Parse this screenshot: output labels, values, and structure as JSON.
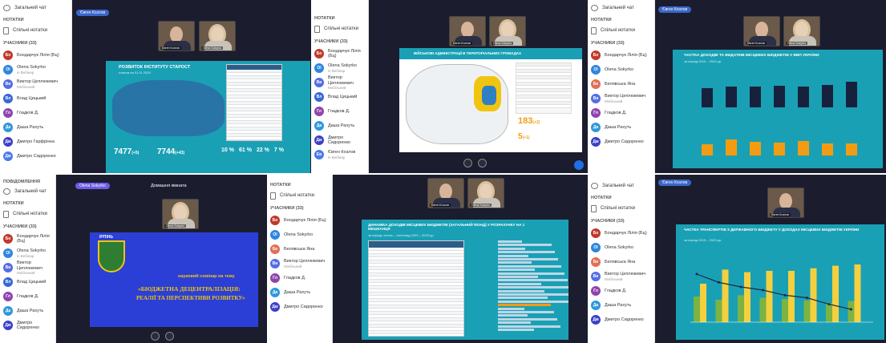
{
  "host_name": "Євген Козлов",
  "cam_labels": {
    "host": "Євген Козлов",
    "guest": "Olena Sokyrko"
  },
  "sidebar": {
    "general_chat": "Загальний чат",
    "notes_header": "НОТАТКИ",
    "shared_notes": "Спільні нотатки",
    "participants_label": "УЧАСНИКИ (33)",
    "participants_label_b": "УЧАСНИКИ (33)",
    "notifications": "ПОВІДОМЛЕННЯ"
  },
  "participants": [
    {
      "initials": "Бо",
      "name": "Бондарчук Лілія (Бц)",
      "sub": "",
      "color": "#c0392b"
    },
    {
      "initials": "Ol",
      "name": "Olena Sokyrko",
      "sub": "in Вебінар",
      "color": "#2e86de"
    },
    {
      "initials": "Ви",
      "name": "Виктор Цеплюкевич",
      "sub": "Мобільний",
      "color": "#546de5"
    },
    {
      "initials": "Вл",
      "name": "Влад Цицький",
      "sub": "",
      "color": "#3867d6"
    },
    {
      "initials": "Гл",
      "name": "Гладков Д.",
      "sub": "",
      "color": "#8e44ad"
    },
    {
      "initials": "Да",
      "name": "Даша Рахуть",
      "sub": "",
      "color": "#2d98da"
    },
    {
      "initials": "Дм",
      "name": "Дмитро Гарфрінка",
      "sub": "",
      "color": "#3c40c6"
    },
    {
      "initials": "Дм",
      "name": "Дмитро Сидоренко",
      "sub": "",
      "color": "#4b7bec"
    }
  ],
  "participants_b": [
    {
      "initials": "Бо",
      "name": "Бондарчук Лілія (Бц)",
      "sub": "",
      "color": "#c0392b"
    },
    {
      "initials": "Ol",
      "name": "Olena Sokyrko",
      "sub": "in Вебінар",
      "color": "#2e86de"
    },
    {
      "initials": "Ви",
      "name": "Виктор Цеплюкевич",
      "sub": "Мобільний",
      "color": "#546de5"
    },
    {
      "initials": "Вл",
      "name": "Влад Цицький",
      "sub": "",
      "color": "#3867d6"
    },
    {
      "initials": "Гл",
      "name": "Гладков Д.",
      "sub": "",
      "color": "#8e44ad"
    },
    {
      "initials": "Да",
      "name": "Даша Рахуть",
      "sub": "",
      "color": "#2d98da"
    },
    {
      "initials": "Дм",
      "name": "Дмитро Сидоренко",
      "sub": "",
      "color": "#3c40c6"
    },
    {
      "initials": "Ев",
      "name": "Євген Козлов",
      "sub": "in Вебінар",
      "color": "#4b7bec"
    }
  ],
  "participants_c": [
    {
      "initials": "Бо",
      "name": "Бондарчук Лілія (Бц)",
      "sub": "",
      "color": "#c0392b"
    },
    {
      "initials": "Ol",
      "name": "Olena Sokyrko",
      "sub": "",
      "color": "#2e86de"
    },
    {
      "initials": "Бе",
      "name": "Белявська Яна",
      "sub": "",
      "color": "#e17055"
    },
    {
      "initials": "Ви",
      "name": "Виктор Цеплюкевич",
      "sub": "Мобільний",
      "color": "#546de5"
    },
    {
      "initials": "Гл",
      "name": "Гладков Д.",
      "sub": "",
      "color": "#8e44ad"
    },
    {
      "initials": "Да",
      "name": "Даша Рахуть",
      "sub": "",
      "color": "#2d98da"
    },
    {
      "initials": "Дм",
      "name": "Дмитро Сидоренко",
      "sub": "",
      "color": "#3c40c6"
    }
  ],
  "panel5": {
    "tab_title": "Домашня кімната",
    "seminar_line1": "науковий семінар на тему",
    "seminar_line2": "«БЮДЖЕТНА ДЕЦЕНТРАЛІЗАЦІЯ:",
    "seminar_line3": "РЕАЛІЇ ТА ПЕРСПЕКТИВИ РОЗВИТКУ»",
    "city_label": "ІРПІНЬ"
  },
  "slides": {
    "s1_title": "РОЗВИТОК ІНСТИТУТУ СТАРОСТ",
    "s1_sub": "станом на 01.01.2024",
    "s1_stat_a": "7477",
    "s1_stat_a_delta": "(+5)",
    "s1_stat_b": "7744",
    "s1_stat_b_delta": "(+43)",
    "s1_pcts": [
      "10 %",
      "61 %",
      "22 %",
      "7 %"
    ],
    "s2_title": "ВІЙСЬКОВІ АДМІНІСТРАЦІЇ В ТЕРИТОРІАЛЬНИХ ГРОМАДАХ",
    "s2_big": "183",
    "s2_big_delta": "(+2)",
    "s2_small": "5",
    "s2_small_delta": "(+1)",
    "s3_title": "ЧАСТКА ДОХОДІВ ТА ВИДАТКІВ МІСЦЕВИХ БЮДЖЕТІВ У ВВП УКРАЇНИ",
    "s3_sub": "за період 2019 – 2023 рр.",
    "s4_title": "ДИНАМІКА ДОХОДІВ МІСЦЕВИХ БЮДЖЕТІВ (ЗАГАЛЬНИЙ ФОНД) У РОЗРАХУНКУ НА 1 МЕШКАНЦЯ",
    "s4_sub": "за період: січень – листопад 2022 – 2023 рр.",
    "s5_title": "ЧАСТКА ТРАНСФЕРТІВ З ДЕРЖАВНОГО БЮДЖЕТУ У ДОХОДАХ МІСЦЕВИХ БЮДЖЕТІВ УКРАЇНИ",
    "s5_sub": "за період 2019 – 2023 рр."
  },
  "chart_bars_top": [
    0.55,
    0.58,
    0.6,
    0.62,
    0.6,
    0.63,
    0.72
  ],
  "chart_bars_bottom": [
    0.35,
    0.5,
    0.42,
    0.4,
    0.45,
    0.38,
    0.38
  ],
  "chart_s5": {
    "green": [
      0.4,
      0.35,
      0.42,
      0.38,
      0.36,
      0.34,
      0.3,
      0.33
    ],
    "yellow": [
      0.6,
      0.82,
      0.78,
      0.8,
      0.8,
      0.84,
      0.88,
      0.9
    ],
    "line": [
      0.75,
      0.62,
      0.55,
      0.5,
      0.42,
      0.38,
      0.28,
      0.2
    ]
  },
  "colors": {
    "teal": "#1fa3b8",
    "navy": "#16213e",
    "orange": "#f39c12",
    "yellow": "#f4d03f",
    "green": "#7cb342",
    "blue_slide": "#2b3fd6"
  }
}
